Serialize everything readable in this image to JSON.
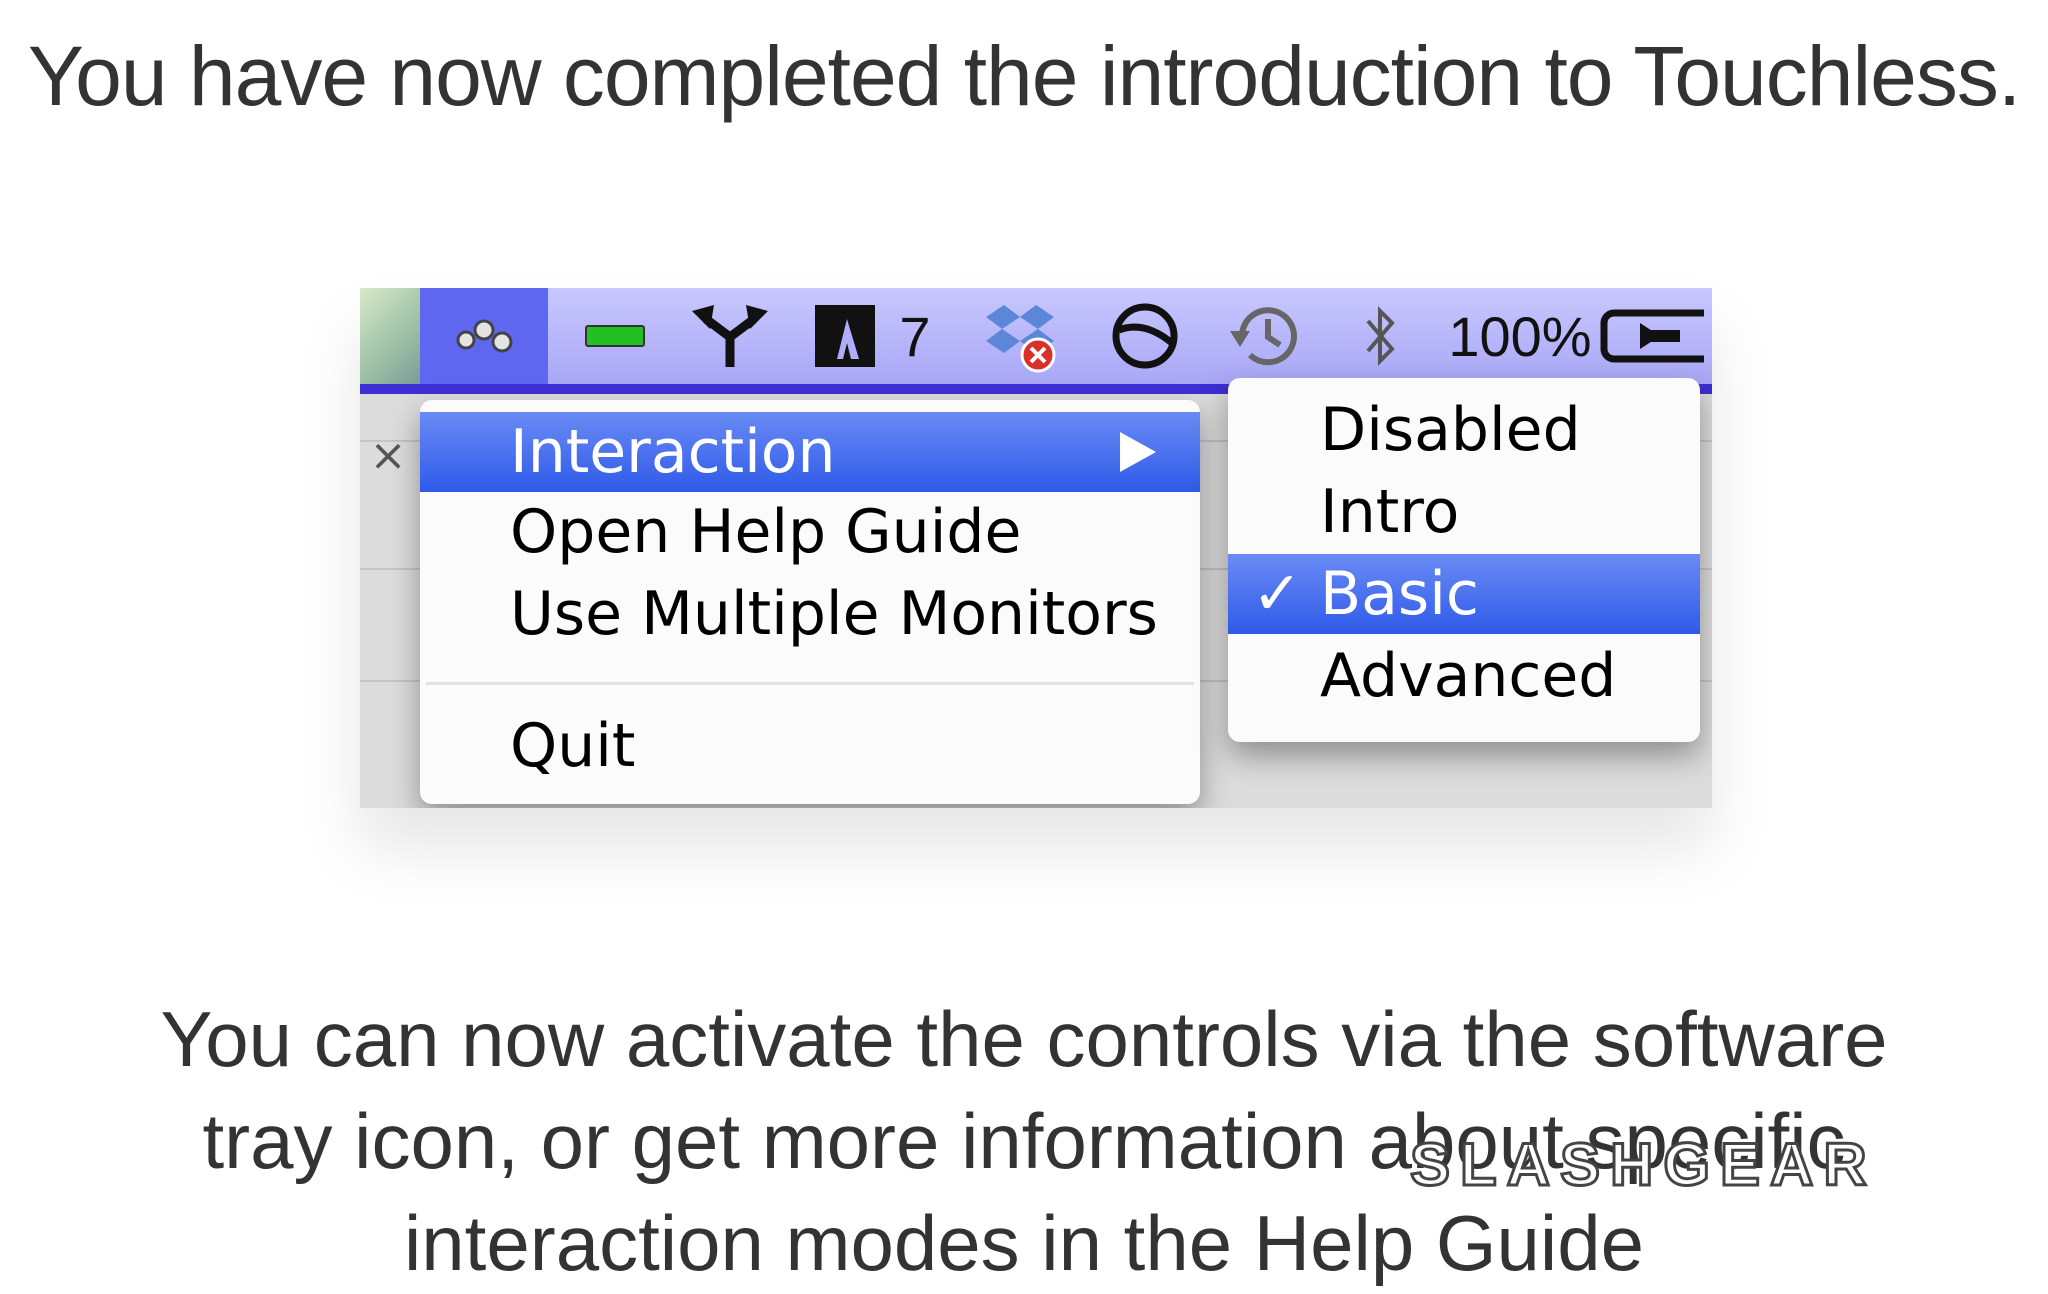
{
  "headline": "You have now completed the introduction to Touchless.",
  "body_lines": [
    "You can now activate the controls via the software",
    "tray icon, or get more information about specific",
    "interaction modes in the Help Guide"
  ],
  "menubar": {
    "icons": [
      "touchless-tray-icon",
      "green-status-icon",
      "fork-arrows-icon",
      "adobe-icon",
      "dropbox-error-icon",
      "circle-slash-icon",
      "time-machine-icon",
      "bluetooth-icon",
      "battery-icon"
    ],
    "adobe_badge": "7",
    "battery_percent": "100%"
  },
  "close_glyph": "×",
  "main_menu": {
    "items": [
      "Interaction",
      "Open Help Guide",
      "Use Multiple Monitors",
      "Quit"
    ],
    "highlighted": "Interaction"
  },
  "submenu": {
    "items": [
      "Disabled",
      "Intro",
      "Basic",
      "Advanced"
    ],
    "checked": "Basic",
    "check_glyph": "✓"
  },
  "colors": {
    "menubar": "#b0aefa",
    "highlight": "#3f6ced",
    "text": "#333333"
  },
  "watermark": "SLASHGEAR"
}
